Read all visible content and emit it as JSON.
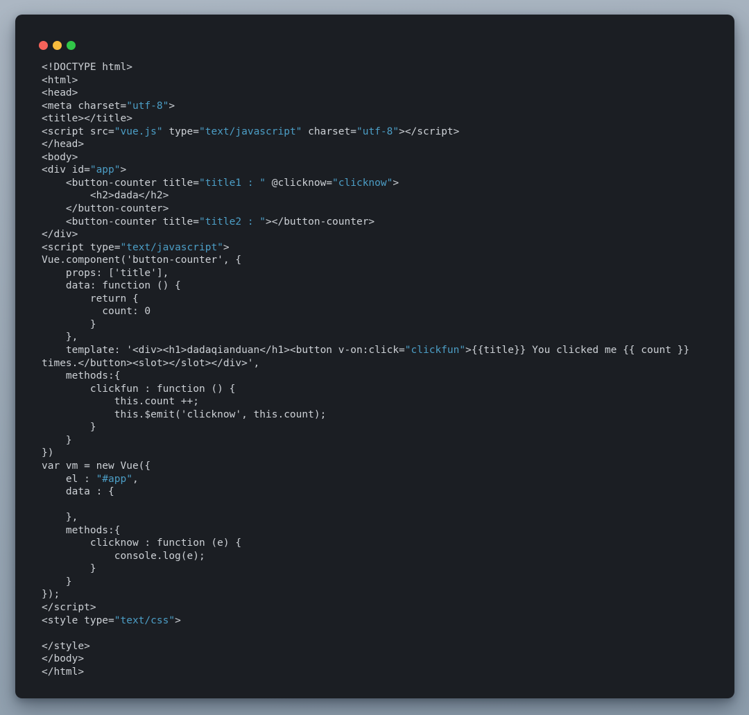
{
  "window": {
    "background": "#1b1e23",
    "titlebar": {
      "traffic_lights": [
        {
          "name": "close",
          "color": "#f6635a"
        },
        {
          "name": "minimize",
          "color": "#f8bc3d"
        },
        {
          "name": "zoom",
          "color": "#31c748"
        }
      ]
    }
  },
  "page": {
    "background_top": "#acb7c3",
    "background_bottom": "#8e9ead"
  },
  "code": {
    "language": "html",
    "text_color": "#cdd1d6",
    "string_color": "#4c9ec6",
    "lines": [
      [
        {
          "t": "<!DOCTYPE html>",
          "c": "p"
        }
      ],
      [
        {
          "t": "<html>",
          "c": "p"
        }
      ],
      [
        {
          "t": "<head>",
          "c": "p"
        }
      ],
      [
        {
          "t": "<meta charset=",
          "c": "p"
        },
        {
          "t": "\"utf-8\"",
          "c": "s"
        },
        {
          "t": ">",
          "c": "p"
        }
      ],
      [
        {
          "t": "<title></title>",
          "c": "p"
        }
      ],
      [
        {
          "t": "<script src=",
          "c": "p"
        },
        {
          "t": "\"vue.js\"",
          "c": "s"
        },
        {
          "t": " type=",
          "c": "p"
        },
        {
          "t": "\"text/javascript\"",
          "c": "s"
        },
        {
          "t": " charset=",
          "c": "p"
        },
        {
          "t": "\"utf-8\"",
          "c": "s"
        },
        {
          "t": "></script>",
          "c": "p"
        }
      ],
      [
        {
          "t": "</head>",
          "c": "p"
        }
      ],
      [
        {
          "t": "<body>",
          "c": "p"
        }
      ],
      [
        {
          "t": "<div id=",
          "c": "p"
        },
        {
          "t": "\"app\"",
          "c": "s"
        },
        {
          "t": ">",
          "c": "p"
        }
      ],
      [
        {
          "t": "    <button-counter title=",
          "c": "p"
        },
        {
          "t": "\"title1 : \"",
          "c": "s"
        },
        {
          "t": " @clicknow=",
          "c": "p"
        },
        {
          "t": "\"clicknow\"",
          "c": "s"
        },
        {
          "t": ">",
          "c": "p"
        }
      ],
      [
        {
          "t": "        <h2>dada</h2>",
          "c": "p"
        }
      ],
      [
        {
          "t": "    </button-counter>",
          "c": "p"
        }
      ],
      [
        {
          "t": "    <button-counter title=",
          "c": "p"
        },
        {
          "t": "\"title2 : \"",
          "c": "s"
        },
        {
          "t": "></button-counter>",
          "c": "p"
        }
      ],
      [
        {
          "t": "</div>",
          "c": "p"
        }
      ],
      [
        {
          "t": "<script type=",
          "c": "p"
        },
        {
          "t": "\"text/javascript\"",
          "c": "s"
        },
        {
          "t": ">",
          "c": "p"
        }
      ],
      [
        {
          "t": "Vue.component('button-counter', {",
          "c": "p"
        }
      ],
      [
        {
          "t": "    props: ['title'],",
          "c": "p"
        }
      ],
      [
        {
          "t": "    data: function () {",
          "c": "p"
        }
      ],
      [
        {
          "t": "        return {",
          "c": "p"
        }
      ],
      [
        {
          "t": "          count: 0",
          "c": "p"
        }
      ],
      [
        {
          "t": "        }",
          "c": "p"
        }
      ],
      [
        {
          "t": "    },",
          "c": "p"
        }
      ],
      [
        {
          "t": "    template: '<div><h1>dadaqianduan</h1><button v-on:click=",
          "c": "p"
        },
        {
          "t": "\"clickfun\"",
          "c": "s"
        },
        {
          "t": ">{{title}} You clicked me {{ count }}",
          "c": "p"
        }
      ],
      [
        {
          "t": "times.</button><slot></slot></div>',",
          "c": "p"
        }
      ],
      [
        {
          "t": "    methods:{",
          "c": "p"
        }
      ],
      [
        {
          "t": "        clickfun : function () {",
          "c": "p"
        }
      ],
      [
        {
          "t": "            this.count ++;",
          "c": "p"
        }
      ],
      [
        {
          "t": "            this.$emit('clicknow', this.count);",
          "c": "p"
        }
      ],
      [
        {
          "t": "        }",
          "c": "p"
        }
      ],
      [
        {
          "t": "    }",
          "c": "p"
        }
      ],
      [
        {
          "t": "})",
          "c": "p"
        }
      ],
      [
        {
          "t": "var vm = new Vue({",
          "c": "p"
        }
      ],
      [
        {
          "t": "    el : ",
          "c": "p"
        },
        {
          "t": "\"#app\"",
          "c": "s"
        },
        {
          "t": ",",
          "c": "p"
        }
      ],
      [
        {
          "t": "    data : {",
          "c": "p"
        }
      ],
      [],
      [
        {
          "t": "    },",
          "c": "p"
        }
      ],
      [
        {
          "t": "    methods:{",
          "c": "p"
        }
      ],
      [
        {
          "t": "        clicknow : function (e) {",
          "c": "p"
        }
      ],
      [
        {
          "t": "            console.log(e);",
          "c": "p"
        }
      ],
      [
        {
          "t": "        }",
          "c": "p"
        }
      ],
      [
        {
          "t": "    }",
          "c": "p"
        }
      ],
      [
        {
          "t": "});",
          "c": "p"
        }
      ],
      [
        {
          "t": "</script>",
          "c": "p"
        }
      ],
      [
        {
          "t": "<style type=",
          "c": "p"
        },
        {
          "t": "\"text/css\"",
          "c": "s"
        },
        {
          "t": ">",
          "c": "p"
        }
      ],
      [],
      [
        {
          "t": "</style>",
          "c": "p"
        }
      ],
      [
        {
          "t": "</body>",
          "c": "p"
        }
      ],
      [
        {
          "t": "</html>",
          "c": "p"
        }
      ]
    ]
  }
}
